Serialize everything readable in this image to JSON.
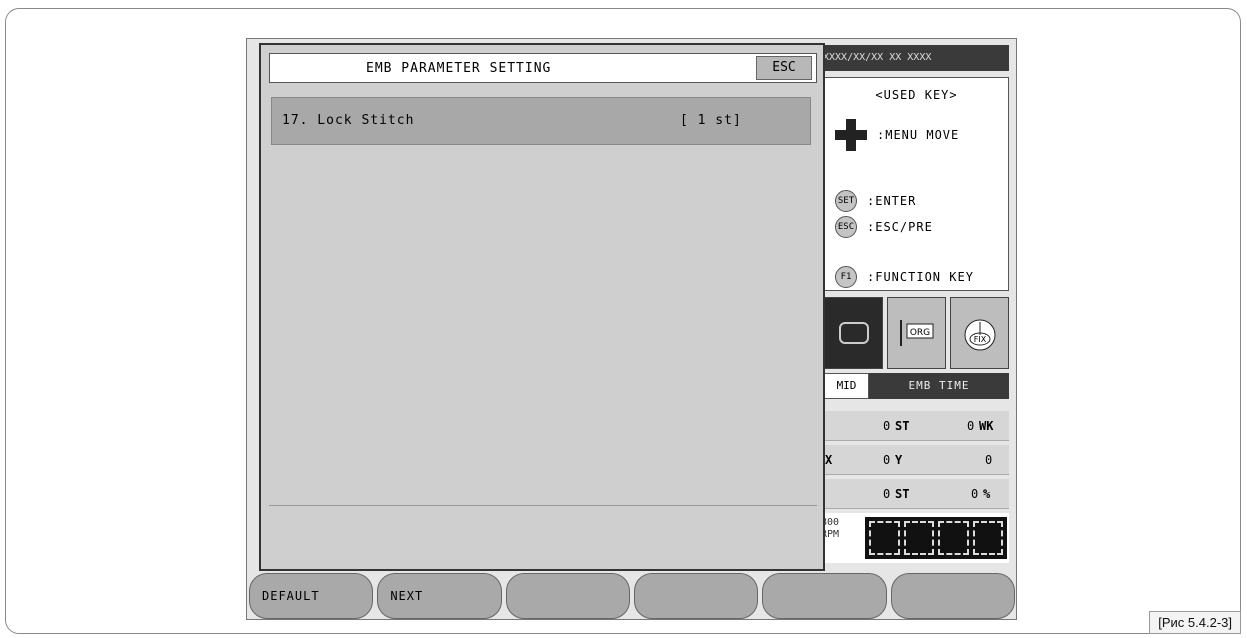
{
  "dialog": {
    "title": "EMB PARAMETER SETTING",
    "esc_label": "ESC",
    "parameter": {
      "label": "17. Lock Stitch",
      "value": "[ 1 st]"
    }
  },
  "header": {
    "datetime": "XXXX/XX/XX XX XXXX"
  },
  "used_keys": {
    "title": "<USED KEY>",
    "menu_move": ":MENU MOVE",
    "set_key": "SET",
    "enter": ":ENTER",
    "esc_key": "ESC",
    "esc_pre": ":ESC/PRE",
    "f1_key": "F1",
    "function_key": ":FUNCTION KEY"
  },
  "icons": [
    "frame-icon",
    "org-icon",
    "fix-gauge-icon"
  ],
  "icon_labels": {
    "org": "ORG",
    "fix": "FIX"
  },
  "tabs": {
    "mid": "MID",
    "emb_time": "EMB TIME"
  },
  "stats": {
    "row1": {
      "st_value": "0",
      "st_unit": "ST",
      "wk_value": "0",
      "wk_unit": "WK"
    },
    "row2": {
      "x_label": "X",
      "x_value": "0",
      "y_label": "Y",
      "y_value": "0"
    },
    "row3": {
      "st_value": "0",
      "st_unit": "ST",
      "pct_value": "0",
      "pct_unit": "%"
    }
  },
  "speed": {
    "rpm_value": "800",
    "rpm_unit": "RPM"
  },
  "buttons": [
    "DEFAULT",
    "NEXT",
    "",
    "",
    "",
    ""
  ],
  "caption": "[Рис 5.4.2-3]"
}
